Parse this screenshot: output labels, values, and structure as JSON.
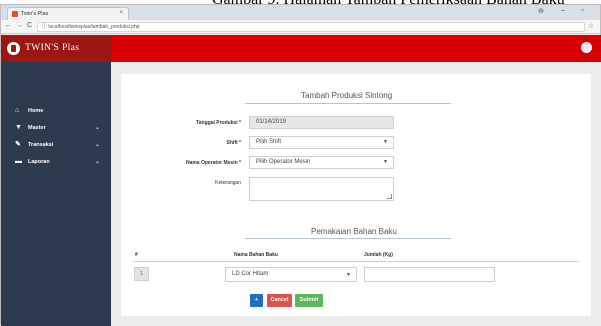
{
  "caption": "Gambar 9. Halaman Tambah Pemeriksaan Bahan Baku",
  "browser": {
    "tab_title": "Twin's Plas",
    "tab_close": "×",
    "url": "localhost/twinsplas/tambah_produksi.php",
    "nav_back": "←",
    "nav_forward": "→",
    "nav_reload": "C",
    "info": "ⓘ",
    "bookmark": "☆",
    "win_user": "⊖",
    "win_min": "–",
    "win_max": "▫"
  },
  "brand": {
    "name": "TWIN'S Plas"
  },
  "sidebar": {
    "items": [
      {
        "label": "Home",
        "icon": "⌂",
        "chevron": ""
      },
      {
        "label": "Master",
        "icon": "▼",
        "chevron": "⌄"
      },
      {
        "label": "Transaksi",
        "icon": "✎",
        "chevron": "⌄"
      },
      {
        "label": "Laporan",
        "icon": "▬",
        "chevron": "⌄"
      }
    ]
  },
  "form": {
    "title": "Tambah Produksi Sintong",
    "tanggal_label": "Tanggal Produksi *",
    "tanggal_value": "01/14/2019",
    "shift_label": "Shift *",
    "shift_value": "Pilih Shift",
    "operator_label": "Nama Operator Mesin *",
    "operator_value": "Pilih Operator Mesin",
    "keterangan_label": "Keterangan",
    "caret": "▼"
  },
  "bahan": {
    "title": "Pemakaian Bahan Baku",
    "col_no": "#",
    "col_nama": "Nama Bahan Baku",
    "col_jumlah": "Jumlah (Kg)",
    "row_no": "1",
    "row_nama": "LD Cor Hitam",
    "row_jumlah": ""
  },
  "buttons": {
    "add": "+",
    "cancel": "Cancel",
    "submit": "Submit"
  },
  "colors": {
    "sidebar": "#2c3b4e",
    "brand": "#9c1714",
    "topbar": "#d60000",
    "add": "#1e6fc8",
    "cancel": "#d9534f",
    "submit": "#5cb85c"
  }
}
